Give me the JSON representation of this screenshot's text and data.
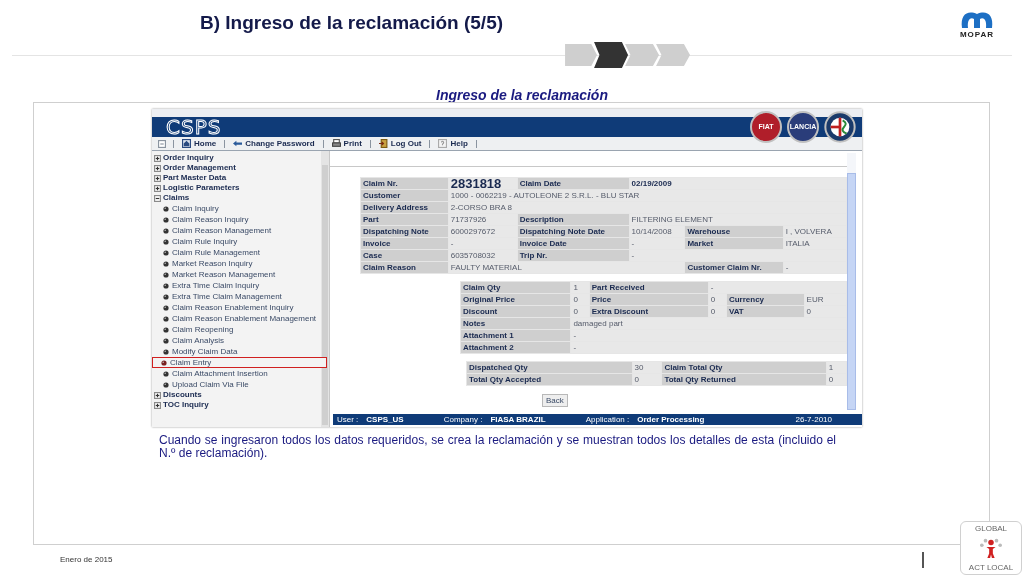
{
  "slide": {
    "title": "B) Ingreso de la reclamación (5/5)",
    "steps": [
      {
        "selected": false
      },
      {
        "selected": true
      },
      {
        "selected": false
      },
      {
        "selected": false
      }
    ],
    "logo_text": "MOPAR",
    "subtitle": "Ingreso de la reclamación",
    "caption": "Cuando se ingresaron todos los datos requeridos, se crea la reclamación y se muestran todos los detalles de esta (incluido el N.º de reclamación).",
    "footer": "Enero de 2015",
    "badge": {
      "top": "GLOBAL",
      "bottom": "ACT LOCAL"
    }
  },
  "app": {
    "logo": "CSPS",
    "brands": [
      {
        "kind": "text",
        "label": "FIAT"
      },
      {
        "kind": "text",
        "label": "LANCIA"
      },
      {
        "kind": "cross"
      }
    ],
    "toolbar": [
      {
        "kind": "collapse"
      },
      {
        "kind": "home",
        "label": "Home"
      },
      {
        "kind": "key",
        "label": "Change Password"
      },
      {
        "kind": "print",
        "label": "Print"
      },
      {
        "kind": "logout",
        "label": "Log Out"
      },
      {
        "kind": "help",
        "label": "Help"
      }
    ],
    "nav": [
      {
        "label": "Order Inquiry",
        "expanded": false
      },
      {
        "label": "Order Management",
        "expanded": false
      },
      {
        "label": "Part Master Data",
        "expanded": false
      },
      {
        "label": "Logistic Parameters",
        "expanded": false
      },
      {
        "label": "Claims",
        "expanded": true,
        "children": [
          {
            "label": "Claim Inquiry",
            "selected": false
          },
          {
            "label": "Claim Reason Inquiry",
            "selected": false
          },
          {
            "label": "Claim Reason Management",
            "selected": false
          },
          {
            "label": "Claim Rule Inquiry",
            "selected": false
          },
          {
            "label": "Claim Rule Management",
            "selected": false
          },
          {
            "label": "Market Reason Inquiry",
            "selected": false
          },
          {
            "label": "Market Reason Management",
            "selected": false
          },
          {
            "label": "Extra Time Claim Inquiry",
            "selected": false
          },
          {
            "label": "Extra Time Claim Management",
            "selected": false
          },
          {
            "label": "Claim Reason Enablement Inquiry",
            "selected": false
          },
          {
            "label": "Claim Reason Enablement Management",
            "selected": false
          },
          {
            "label": "Claim Reopening",
            "selected": false
          },
          {
            "label": "Claim Analysis",
            "selected": false
          },
          {
            "label": "Modify Claim Data",
            "selected": false
          },
          {
            "label": "Claim Entry",
            "selected": true
          },
          {
            "label": "Claim Attachment Insertion",
            "selected": false
          },
          {
            "label": "Upload Claim Via File",
            "selected": false
          }
        ]
      },
      {
        "label": "Discounts",
        "expanded": false
      },
      {
        "label": "TOC Inquiry",
        "expanded": false
      }
    ],
    "claim_table": [
      [
        {
          "kind": "label",
          "text": "Claim Nr."
        },
        {
          "kind": "big",
          "text": "2831818"
        },
        {
          "kind": "label",
          "text": "Claim Date"
        },
        {
          "kind": "strong",
          "text": "02/19/2009"
        },
        {
          "kind": "blank"
        },
        {
          "kind": "blank"
        }
      ],
      [
        {
          "kind": "label",
          "text": "Customer"
        },
        {
          "kind": "value",
          "text": "1000 - 0062219 - AUTOLEONE 2 S.R.L. - BLU STAR"
        },
        {
          "kind": "blank"
        },
        {
          "kind": "blank"
        },
        {
          "kind": "blank"
        },
        {
          "kind": "blank"
        }
      ],
      [
        {
          "kind": "label",
          "text": "Delivery Address"
        },
        {
          "kind": "value",
          "text": "2-CORSO BRA 8"
        },
        {
          "kind": "blank"
        },
        {
          "kind": "blank"
        },
        {
          "kind": "blank"
        },
        {
          "kind": "blank"
        }
      ],
      [
        {
          "kind": "label",
          "text": "Part"
        },
        {
          "kind": "value",
          "text": "71737926"
        },
        {
          "kind": "label",
          "text": "Description"
        },
        {
          "kind": "value",
          "text": "FILTERING ELEMENT"
        },
        {
          "kind": "blank"
        },
        {
          "kind": "blank"
        }
      ],
      [
        {
          "kind": "label",
          "text": "Dispatching Note"
        },
        {
          "kind": "value",
          "text": "6000297672"
        },
        {
          "kind": "label",
          "text": "Dispatching Note Date"
        },
        {
          "kind": "value",
          "text": "10/14/2008"
        },
        {
          "kind": "label",
          "text": "Warehouse"
        },
        {
          "kind": "value",
          "text": "I , VOLVERA"
        }
      ],
      [
        {
          "kind": "label",
          "text": "Invoice"
        },
        {
          "kind": "value",
          "text": "-"
        },
        {
          "kind": "label",
          "text": "Invoice Date"
        },
        {
          "kind": "value",
          "text": "-"
        },
        {
          "kind": "label",
          "text": "Market"
        },
        {
          "kind": "value",
          "text": "ITALIA"
        }
      ],
      [
        {
          "kind": "label",
          "text": "Case"
        },
        {
          "kind": "value",
          "text": "6035708032"
        },
        {
          "kind": "label",
          "text": "Trip Nr."
        },
        {
          "kind": "value",
          "text": "-"
        },
        {
          "kind": "blank"
        },
        {
          "kind": "blank"
        }
      ],
      [
        {
          "kind": "label",
          "text": "Claim Reason"
        },
        {
          "kind": "value",
          "text": "FAULTY MATERIAL"
        },
        {
          "kind": "blank"
        },
        {
          "kind": "blank"
        },
        {
          "kind": "label",
          "text": "Customer Claim Nr."
        },
        {
          "kind": "value",
          "text": "-"
        }
      ]
    ],
    "qty_table": [
      [
        {
          "kind": "label",
          "text": "Claim Qty"
        },
        {
          "kind": "value",
          "text": "1"
        },
        {
          "kind": "label",
          "text": "Part Received"
        },
        {
          "kind": "value",
          "text": "-"
        },
        {
          "kind": "blank"
        },
        {
          "kind": "blank"
        }
      ],
      [
        {
          "kind": "label",
          "text": "Original Price"
        },
        {
          "kind": "value",
          "text": "0"
        },
        {
          "kind": "label",
          "text": "Price"
        },
        {
          "kind": "value",
          "text": "0"
        },
        {
          "kind": "label",
          "text": "Currency"
        },
        {
          "kind": "value",
          "text": "EUR"
        }
      ],
      [
        {
          "kind": "label",
          "text": "Discount"
        },
        {
          "kind": "value",
          "text": "0"
        },
        {
          "kind": "label",
          "text": "Extra Discount"
        },
        {
          "kind": "value",
          "text": "0"
        },
        {
          "kind": "label",
          "text": "VAT"
        },
        {
          "kind": "value",
          "text": "0"
        }
      ],
      [
        {
          "kind": "label",
          "text": "Notes"
        },
        {
          "kind": "value",
          "text": "damaged part"
        },
        {
          "kind": "blank"
        },
        {
          "kind": "blank"
        },
        {
          "kind": "blank"
        },
        {
          "kind": "blank"
        }
      ],
      [
        {
          "kind": "label",
          "text": "Attachment 1"
        },
        {
          "kind": "value",
          "text": "-"
        },
        {
          "kind": "blank"
        },
        {
          "kind": "blank"
        },
        {
          "kind": "blank"
        },
        {
          "kind": "blank"
        }
      ],
      [
        {
          "kind": "label",
          "text": "Attachment 2"
        },
        {
          "kind": "value",
          "text": "-"
        },
        {
          "kind": "blank"
        },
        {
          "kind": "blank"
        },
        {
          "kind": "blank"
        },
        {
          "kind": "blank"
        }
      ]
    ],
    "totals_table": [
      [
        {
          "kind": "label",
          "text": "Dispatched Qty"
        },
        {
          "kind": "value",
          "text": "30"
        },
        {
          "kind": "label",
          "text": "Claim Total Qty"
        },
        {
          "kind": "value",
          "text": "1"
        }
      ],
      [
        {
          "kind": "label",
          "text": "Total Qty Accepted"
        },
        {
          "kind": "value",
          "text": "0"
        },
        {
          "kind": "label",
          "text": "Total Qty Returned"
        },
        {
          "kind": "value",
          "text": "0"
        }
      ]
    ],
    "back_button": "Back",
    "status_bar": [
      {
        "kind": "label",
        "text": "User :"
      },
      {
        "kind": "value",
        "text": "CSPS_US"
      },
      {
        "kind": "label",
        "text": "Company :"
      },
      {
        "kind": "value",
        "text": "FIASA BRAZIL"
      },
      {
        "kind": "label",
        "text": "Application :"
      },
      {
        "kind": "value",
        "text": "Order Processing"
      },
      {
        "kind": "date",
        "text": "26-7-2010"
      }
    ]
  }
}
